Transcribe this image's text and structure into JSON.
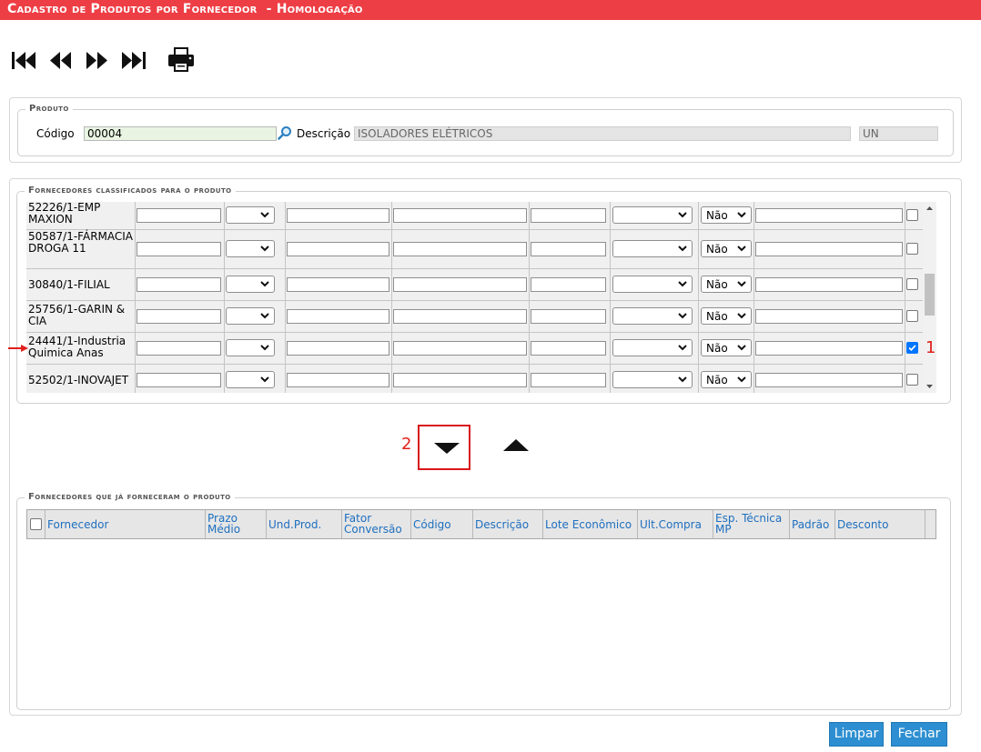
{
  "window": {
    "title": "Cadastro de Produtos por Fornecedor  - Homologação"
  },
  "toolbar": {
    "icons": [
      "first-icon",
      "previous-icon",
      "next-icon",
      "last-icon",
      "print-icon"
    ]
  },
  "produto": {
    "legend": "Produto",
    "codigo_label": "Código",
    "codigo_value": "00004",
    "descricao_label": "Descrição",
    "descricao_value": "ISOLADORES ELÉTRICOS",
    "unidade_value": "UN"
  },
  "classificados": {
    "legend": "Fornecedores classificados para o produto",
    "rows": [
      {
        "name": "52226/1-EMP MAXION",
        "select_value": "Não",
        "checked": false
      },
      {
        "name": "50587/1-FÁRMACIA DROGA 11",
        "select_value": "Não",
        "checked": false
      },
      {
        "name": "30840/1-FILIAL",
        "select_value": "Não",
        "checked": false
      },
      {
        "name": "25756/1-GARIN & CIA",
        "select_value": "Não",
        "checked": false
      },
      {
        "name": "24441/1-Industria Quimica Anas",
        "select_value": "Não",
        "checked": true
      },
      {
        "name": "52502/1-INOVAJET",
        "select_value": "Não",
        "checked": false
      }
    ]
  },
  "annotations": {
    "mark1": "1",
    "mark2": "2"
  },
  "ja_forneceram": {
    "legend": "Fornecedores que já forneceram o produto",
    "columns": [
      "Fornecedor",
      "Prazo Médio",
      "Und.Prod.",
      "Fator Conversão",
      "Código",
      "Descrição",
      "Lote Econômico",
      "Ult.Compra",
      "Esp. Técnica MP",
      "Padrão",
      "Desconto"
    ]
  },
  "buttons": {
    "limpar": "Limpar",
    "fechar": "Fechar"
  },
  "colors": {
    "title_bar": "#ee3e45",
    "button": "#2d8fd1",
    "link": "#1e6fbf",
    "annotation": "#e0201c"
  }
}
